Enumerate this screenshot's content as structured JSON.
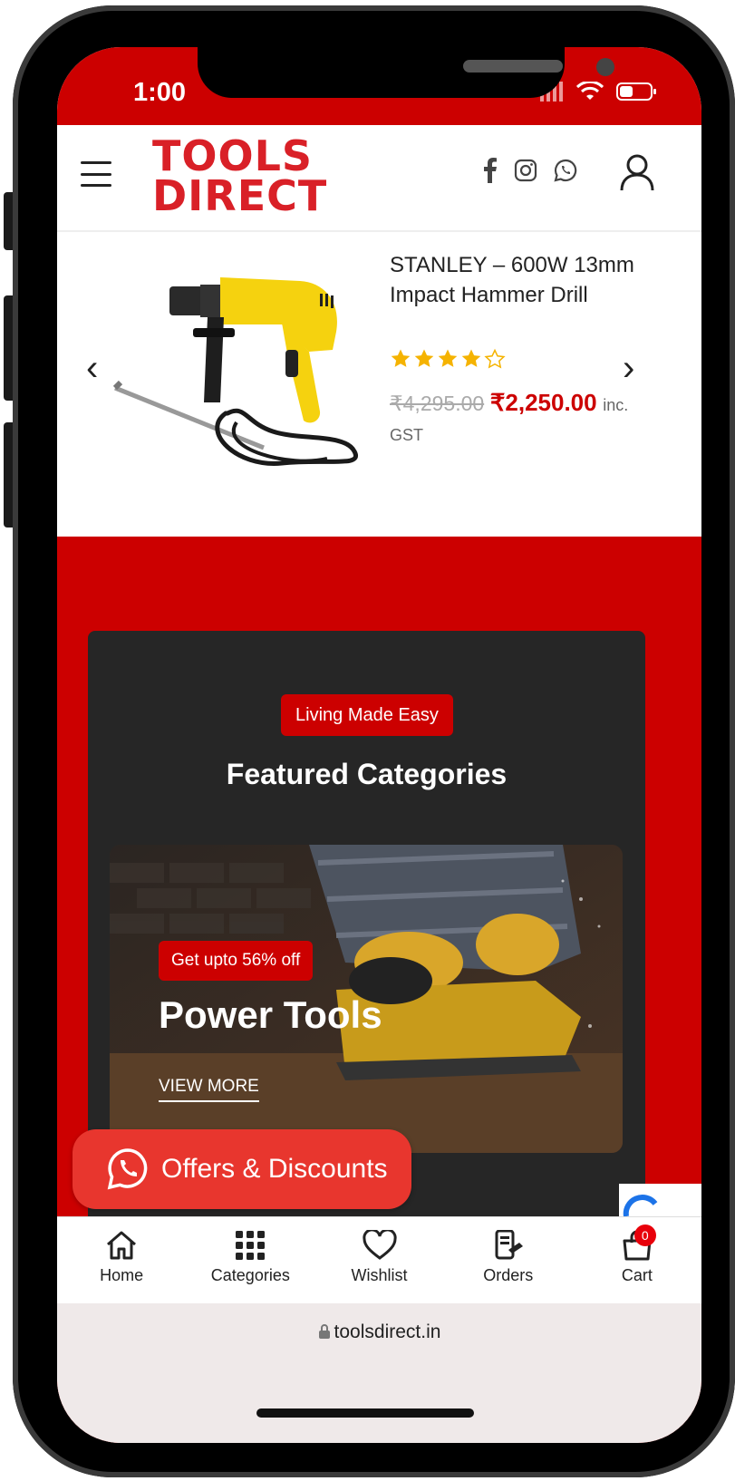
{
  "status_bar": {
    "time": "1:00"
  },
  "header": {
    "logo_line1": "TOOLS",
    "logo_line2": "DIRECT"
  },
  "product": {
    "title": "STANLEY – 600W 13mm Impact Hammer Drill",
    "rating": 4,
    "rating_max": 5,
    "old_price": "₹4,295.00",
    "new_price": "₹2,250.00",
    "tax_note_1": "inc.",
    "tax_note_2": "GST",
    "prev_label": "‹",
    "next_label": "›"
  },
  "featured": {
    "badge": "Living Made Easy",
    "title": "Featured Categories",
    "banner": {
      "badge": "Get upto 56% off",
      "title": "Power Tools",
      "link": "VIEW MORE"
    }
  },
  "offers_button": {
    "label": "Offers & Discounts"
  },
  "bottom_nav": {
    "items": [
      {
        "label": "Home",
        "icon": "home-icon"
      },
      {
        "label": "Categories",
        "icon": "grid-icon"
      },
      {
        "label": "Wishlist",
        "icon": "heart-icon"
      },
      {
        "label": "Orders",
        "icon": "orders-icon"
      },
      {
        "label": "Cart",
        "icon": "cart-icon"
      }
    ],
    "cart_count": "0"
  },
  "browser": {
    "url": "toolsdirect.in"
  },
  "colors": {
    "brand_red": "#cc0000",
    "offers_red": "#e8362e",
    "star": "#f5b301",
    "dark_card": "#262626"
  }
}
